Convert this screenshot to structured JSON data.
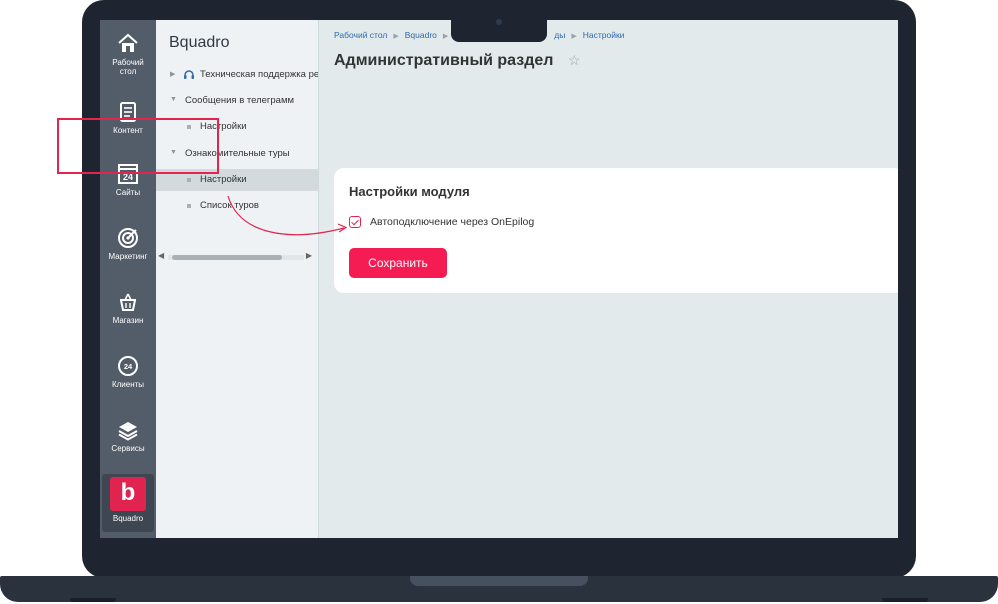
{
  "rail": {
    "items": [
      {
        "label": "Рабочий стол",
        "icon": "home-icon"
      },
      {
        "label": "Контент",
        "icon": "document-icon"
      },
      {
        "label": "Сайты",
        "icon": "calendar-24-icon"
      },
      {
        "label": "Маркетинг",
        "icon": "target-icon"
      },
      {
        "label": "Магазин",
        "icon": "basket-icon"
      },
      {
        "label": "Клиенты",
        "icon": "clients-24-icon"
      },
      {
        "label": "Сервисы",
        "icon": "layers-icon"
      }
    ],
    "brand": {
      "letter": "b",
      "label": "Bquadro",
      "color": "#e0244f"
    }
  },
  "tree": {
    "title": "Bquadro",
    "rows": [
      {
        "label": "Техническая поддержка ре"
      },
      {
        "label": "Сообщения в телеграмм"
      },
      {
        "label": "Настройки"
      },
      {
        "label": "Ознакомительные туры"
      },
      {
        "label": "Настройки"
      },
      {
        "label": "Список туров"
      }
    ]
  },
  "breadcrumb": {
    "items": [
      "Рабочий стол",
      "Bquadro",
      "ды",
      "Настройки"
    ]
  },
  "page": {
    "title": "Административный раздел"
  },
  "card": {
    "title": "Настройки модуля",
    "checkbox_label": "Автоподключение через OnEpilog",
    "checkbox_checked": true,
    "save_label": "Сохранить"
  },
  "colors": {
    "accent": "#f41c52",
    "highlight": "#e2244f",
    "rail": "#535c69"
  }
}
